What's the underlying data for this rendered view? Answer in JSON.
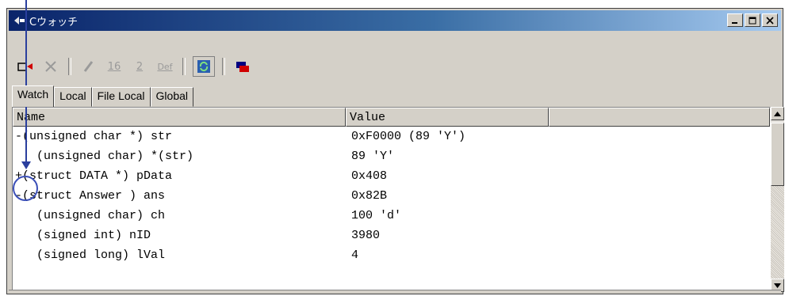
{
  "window": {
    "title": "Cウォッチ",
    "caption_buttons": [
      "minimize",
      "maximize",
      "close"
    ]
  },
  "toolbar": {
    "buttons": [
      {
        "name": "add-watch",
        "icon": "add-watch-icon",
        "enabled": true
      },
      {
        "name": "delete",
        "icon": "delete-x-icon",
        "enabled": false
      },
      {
        "name": "edit",
        "icon": "pencil-icon",
        "enabled": false
      },
      {
        "name": "hex",
        "label": "16",
        "enabled": false
      },
      {
        "name": "binary",
        "label": "2",
        "enabled": false
      },
      {
        "name": "default",
        "label": "Def",
        "enabled": false
      },
      {
        "name": "refresh",
        "icon": "refresh-icon",
        "enabled": true
      },
      {
        "name": "record",
        "icon": "record-icon",
        "enabled": true
      }
    ]
  },
  "tabs": [
    {
      "label": "Watch",
      "active": true
    },
    {
      "label": "Local",
      "active": false
    },
    {
      "label": "File Local",
      "active": false
    },
    {
      "label": "Global",
      "active": false
    }
  ],
  "columns": {
    "name": "Name",
    "value": "Value"
  },
  "rows": [
    {
      "name": "-(unsigned char *) str",
      "value": "0xF0000 (89 'Y')"
    },
    {
      "name": "   (unsigned char) *(str)",
      "value": "89 'Y'"
    },
    {
      "name": "+(struct DATA *) pData",
      "value": "0x408"
    },
    {
      "name": "-(struct Answer ) ans",
      "value": "0x82B"
    },
    {
      "name": "   (unsigned char) ch",
      "value": "100 'd'"
    },
    {
      "name": "   (signed int) nID",
      "value": "3980"
    },
    {
      "name": "   (signed long) lVal",
      "value": "4"
    }
  ],
  "colors": {
    "title_start": "#0a246a",
    "title_end": "#a6caf0",
    "callout": "#2a3f9e",
    "face": "#d4d0c8"
  }
}
